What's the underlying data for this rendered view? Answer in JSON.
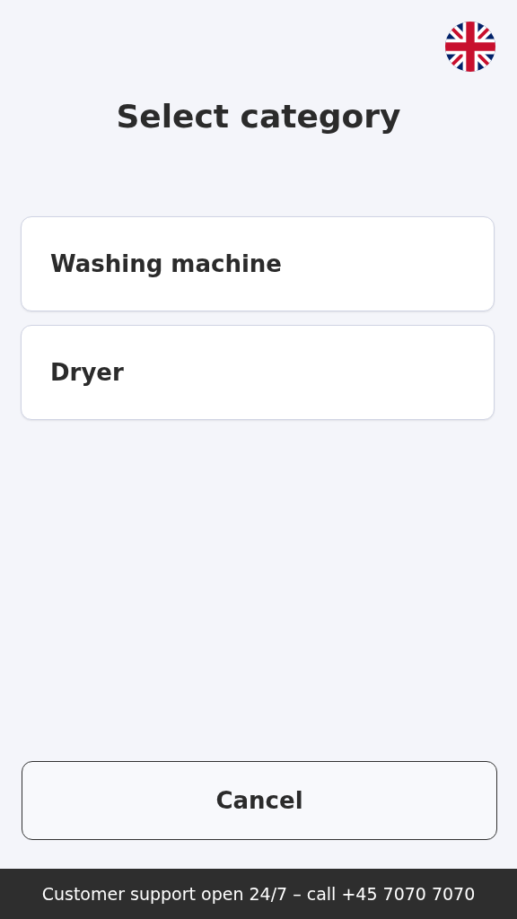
{
  "title": "Select category",
  "categories": [
    {
      "label": "Washing machine"
    },
    {
      "label": "Dryer"
    }
  ],
  "cancel_button": "Cancel",
  "footer": "Customer support open 24/7 – call +45 7070 7070"
}
